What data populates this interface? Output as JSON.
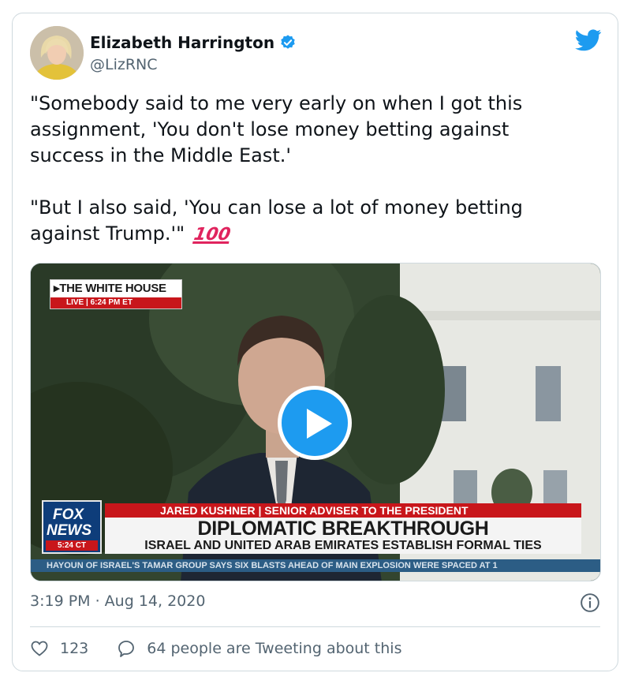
{
  "tweet": {
    "author_name": "Elizabeth Harrington",
    "author_handle": "@LizRNC",
    "text_line1": "\"Somebody said to me very early on when I got this",
    "text_line2": "assignment, 'You don't lose money betting against",
    "text_line3": "success in the Middle East.'",
    "text_line4": "\"But I also said, 'You can lose a lot of money betting",
    "text_line5": "against Trump.'\"",
    "emoji": "100",
    "timestamp": "3:19 PM · Aug 14, 2020",
    "like_count": "123",
    "reply_text": "64 people are Tweeting about this"
  },
  "video": {
    "location_tag": "THE WHITE HOUSE",
    "live_label": "LIVE  |  6:24 PM ET",
    "name_bar": "JARED KUSHNER  |  SENIOR ADVISER TO THE PRESIDENT",
    "headline": "DIPLOMATIC BREAKTHROUGH",
    "subhead": "ISRAEL AND UNITED ARAB EMIRATES ESTABLISH FORMAL TIES",
    "network_line1": "FOX",
    "network_line2": "NEWS",
    "network_time": "5:24 CT",
    "ticker": "HAYOUN OF ISRAEL'S TAMAR GROUP SAYS SIX BLASTS AHEAD OF MAIN EXPLOSION WERE SPACED AT 1"
  },
  "colors": {
    "twitter_blue": "#1d9bf0",
    "text_primary": "#0f1419",
    "text_secondary": "#536471",
    "fox_red": "#c8161b"
  },
  "icons": {
    "verified": "verified-badge-icon",
    "brand": "twitter-bird-icon",
    "play": "play-icon",
    "info": "info-icon",
    "like": "heart-icon",
    "reply": "speech-bubble-icon"
  }
}
